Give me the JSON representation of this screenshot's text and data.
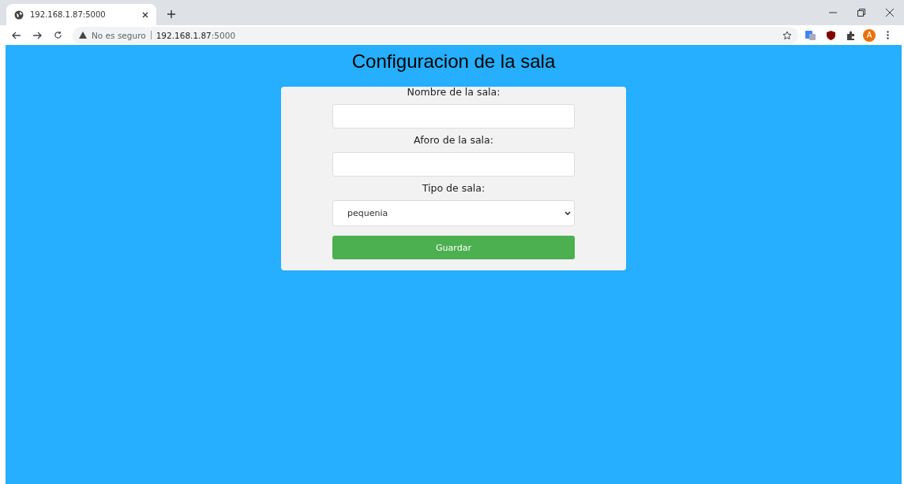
{
  "browser": {
    "tab_title": "192.168.1.87:5000",
    "security_label": "No es seguro",
    "url_host": "192.168.1.87",
    "url_port": ":5000",
    "avatar_letter": "A"
  },
  "page": {
    "title": "Configuracion de la sala",
    "fields": [
      {
        "kind": "text",
        "label": "Nombre de la sala:"
      },
      {
        "kind": "text",
        "label": "Aforo de la sala:"
      },
      {
        "kind": "select",
        "label": "Tipo de sala:",
        "value": "pequenia"
      }
    ],
    "submit": "Guardar"
  }
}
